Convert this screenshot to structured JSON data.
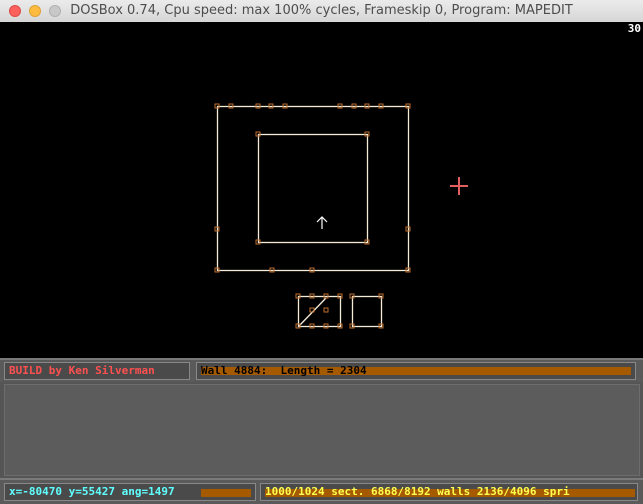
{
  "window": {
    "title": "DOSBox 0.74, Cpu speed: max 100% cycles, Frameskip  0, Program:  MAPEDIT"
  },
  "screen": {
    "fps": "30"
  },
  "status": {
    "credit": "BUILD by Ken Silverman",
    "wall_info": "Wall 4884:  Length = 2304",
    "coords": "x=-80470 y=55427 ang=1497",
    "stats": "1000/1024 sect. 6868/8192 walls 2136/4096 spri"
  },
  "colors": {
    "wall_line": "#f4ecd8",
    "vertex": "#c07030",
    "cursor": "#e06060",
    "credit_text": "#ff5050",
    "coords_text": "#60ffff",
    "stats_text": "#ffff50",
    "bar_fill": "#a65a00"
  }
}
